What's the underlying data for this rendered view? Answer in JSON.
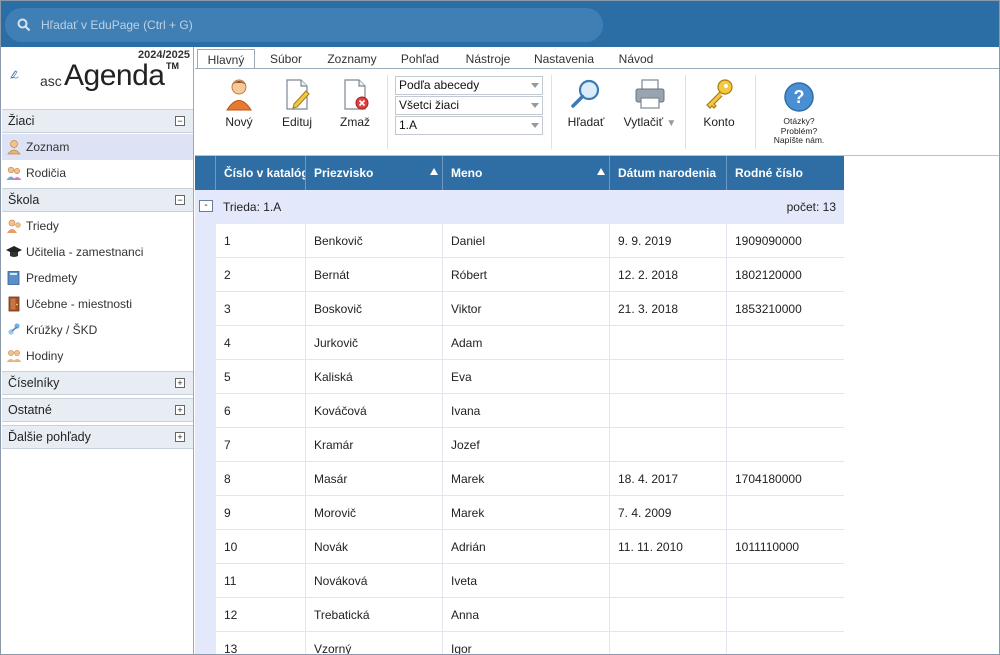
{
  "search": {
    "placeholder": "Hľadať v EduPage (Ctrl + G)",
    "icon": "search-icon"
  },
  "brand": {
    "year": "2024/2025",
    "asc": "asc",
    "name": "Agenda",
    "tm": "TM"
  },
  "sidebar": {
    "sections": [
      {
        "label": "Žiaci",
        "toggle": "−",
        "items": [
          {
            "label": "Zoznam",
            "icon": "student-icon",
            "active": true
          },
          {
            "label": "Rodičia",
            "icon": "parents-icon"
          }
        ]
      },
      {
        "label": "Škola",
        "toggle": "−",
        "items": [
          {
            "label": "Triedy",
            "icon": "classes-icon"
          },
          {
            "label": "Učitelia - zamestnanci",
            "icon": "graduation-cap-icon"
          },
          {
            "label": "Predmety",
            "icon": "book-icon"
          },
          {
            "label": "Učebne - miestnosti",
            "icon": "door-icon"
          },
          {
            "label": "Krúžky / ŠKD",
            "icon": "clubs-icon"
          },
          {
            "label": "Hodiny",
            "icon": "lessons-icon"
          }
        ]
      },
      {
        "label": "Číselníky",
        "toggle": "+"
      },
      {
        "label": "Ostatné",
        "toggle": "+"
      },
      {
        "label": "Ďalšie pohľady",
        "toggle": "+"
      }
    ]
  },
  "ribbon": {
    "tabs": [
      "Hlavný",
      "Súbor",
      "Zoznamy",
      "Pohľad",
      "Nástroje",
      "Nastavenia",
      "Návod"
    ],
    "active_tab": "Hlavný",
    "buttons": {
      "new": "Nový",
      "edit": "Edituj",
      "delete": "Zmaž",
      "find": "Hľadať",
      "print": "Vytlačiť",
      "account": "Konto"
    },
    "combos": {
      "sort": "Podľa abecedy",
      "filter": "Všetci žiaci",
      "class": "1.A"
    },
    "help": {
      "line1": "Otázky?",
      "line2": "Problém?",
      "line3": "Napíšte nám."
    }
  },
  "table": {
    "columns": [
      "Číslo v katalógu",
      "Priezvisko",
      "Meno",
      "Dátum narodenia",
      "Rodné číslo"
    ],
    "group": {
      "label": "Trieda: 1.A",
      "count": "počet: 13",
      "toggle": "-"
    },
    "rows": [
      [
        "1",
        "Benkovič",
        "Daniel",
        "9. 9. 2019",
        "1909090000"
      ],
      [
        "2",
        "Bernát",
        "Róbert",
        "12. 2. 2018",
        "1802120000"
      ],
      [
        "3",
        "Boskovič",
        "Viktor",
        "21. 3. 2018",
        "1853210000"
      ],
      [
        "4",
        "Jurkovič",
        "Adam",
        "",
        ""
      ],
      [
        "5",
        "Kaliská",
        "Eva",
        "",
        ""
      ],
      [
        "6",
        "Kováčová",
        "Ivana",
        "",
        ""
      ],
      [
        "7",
        "Kramár",
        "Jozef",
        "",
        ""
      ],
      [
        "8",
        "Masár",
        "Marek",
        "18. 4. 2017",
        "1704180000"
      ],
      [
        "9",
        "Morovič",
        "Marek",
        "7. 4. 2009",
        ""
      ],
      [
        "10",
        "Novák",
        "Adrián",
        "11. 11. 2010",
        "1011110000"
      ],
      [
        "11",
        "Nováková",
        "Iveta",
        "",
        ""
      ],
      [
        "12",
        "Trebatická",
        "Anna",
        "",
        ""
      ],
      [
        "13",
        "Vzorný",
        "Igor",
        "",
        ""
      ]
    ]
  },
  "colors": {
    "topbar": "#2b6ea6",
    "header": "#2f6ea5",
    "group": "#e3e8fa",
    "active_nav": "#dde3f4"
  }
}
